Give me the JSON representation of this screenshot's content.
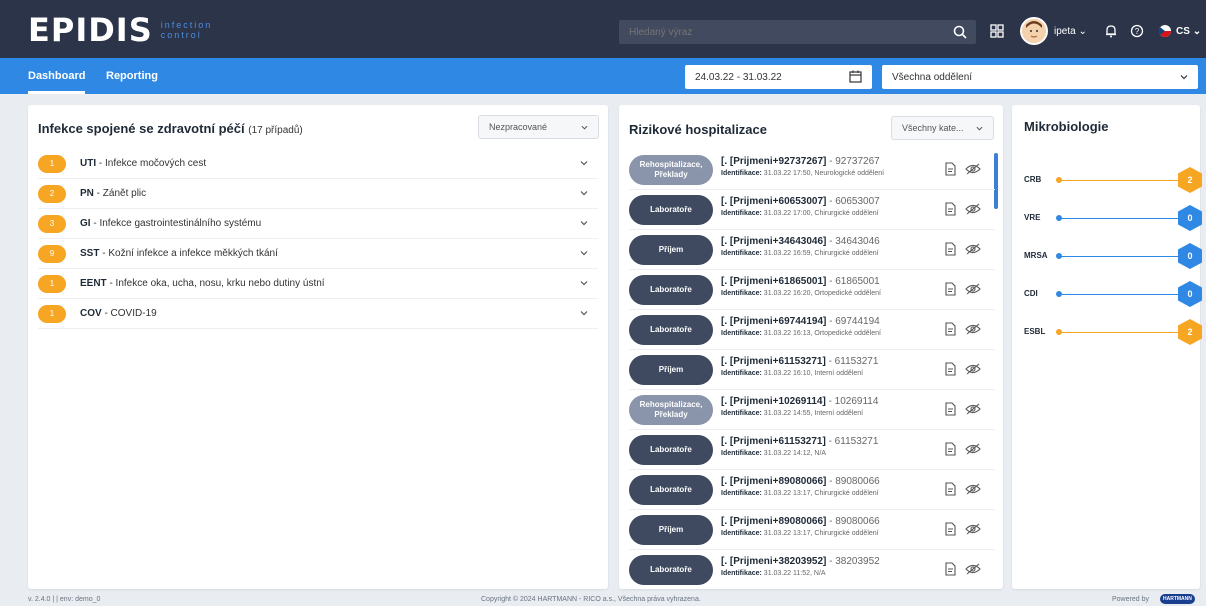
{
  "header": {
    "logo_text": "EPIDIS",
    "logo_sub_line1": "infection",
    "logo_sub_line2": "control",
    "search_placeholder": "Hledaný výraz",
    "username": "ipeta",
    "language": "CS"
  },
  "nav": {
    "tabs": [
      {
        "label": "Dashboard"
      },
      {
        "label": "Reporting"
      }
    ],
    "date_range": "24.03.22 - 31.03.22",
    "department": "Všechna oddělení"
  },
  "infections": {
    "title": "Infekce spojené se zdravotní péčí",
    "count": "(17 případů)",
    "filter": "Nezpracované",
    "rows": [
      {
        "count": "1",
        "code": "UTI",
        "desc": " - Infekce močových cest"
      },
      {
        "count": "2",
        "code": "PN",
        "desc": " - Zánět plic"
      },
      {
        "count": "3",
        "code": "GI",
        "desc": " - Infekce gastrointestinálního systému"
      },
      {
        "count": "9",
        "code": "SST",
        "desc": " - Kožní infekce a infekce měkkých tkání"
      },
      {
        "count": "1",
        "code": "EENT",
        "desc": " - Infekce oka, ucha, nosu, krku nebo dutiny ústní"
      },
      {
        "count": "1",
        "code": "COV",
        "desc": " - COVID-19"
      }
    ]
  },
  "hospitalizations": {
    "title": "Rizikové hospitalizace",
    "filter": "Všechny kate...",
    "detail_label": "Identifikace:",
    "rows": [
      {
        "pill": "Rehospitalizace, Překlady",
        "light": true,
        "name": "[. [Prijmeni+92737267]",
        "id": " - 92737267",
        "detail": " 31.03.22 17:50, Neurologické oddělení"
      },
      {
        "pill": "Laboratoře",
        "light": false,
        "name": "[. [Prijmeni+60653007]",
        "id": " - 60653007",
        "detail": " 31.03.22 17:00, Chirurgické oddělení"
      },
      {
        "pill": "Příjem",
        "light": false,
        "name": "[. [Prijmeni+34643046]",
        "id": " - 34643046",
        "detail": " 31.03.22 16:59, Chirurgické oddělení"
      },
      {
        "pill": "Laboratoře",
        "light": false,
        "name": "[. [Prijmeni+61865001]",
        "id": " - 61865001",
        "detail": " 31.03.22 16:20, Ortopedické oddělení"
      },
      {
        "pill": "Laboratoře",
        "light": false,
        "name": "[. [Prijmeni+69744194]",
        "id": " - 69744194",
        "detail": " 31.03.22 16:13, Ortopedické oddělení"
      },
      {
        "pill": "Příjem",
        "light": false,
        "name": "[. [Prijmeni+61153271]",
        "id": " - 61153271",
        "detail": " 31.03.22 16:10, Interní oddělení"
      },
      {
        "pill": "Rehospitalizace, Překlady",
        "light": true,
        "name": "[. [Prijmeni+10269114]",
        "id": " - 10269114",
        "detail": " 31.03.22 14:55, Interní oddělení"
      },
      {
        "pill": "Laboratoře",
        "light": false,
        "name": "[. [Prijmeni+61153271]",
        "id": " - 61153271",
        "detail": " 31.03.22 14:12, N/A"
      },
      {
        "pill": "Laboratoře",
        "light": false,
        "name": "[. [Prijmeni+89080066]",
        "id": " - 89080066",
        "detail": " 31.03.22 13:17, Chirurgické oddělení"
      },
      {
        "pill": "Příjem",
        "light": false,
        "name": "[. [Prijmeni+89080066]",
        "id": " - 89080066",
        "detail": " 31.03.22 13:17, Chirurgické oddělení"
      },
      {
        "pill": "Laboratoře",
        "light": false,
        "name": "[. [Prijmeni+38203952]",
        "id": " - 38203952",
        "detail": " 31.03.22 11:52, N/A"
      }
    ]
  },
  "microbiology": {
    "title": "Mikrobiologie",
    "rows": [
      {
        "label": "CRB",
        "value": "2",
        "color": "#f6a623"
      },
      {
        "label": "VRE",
        "value": "0",
        "color": "#2f89e4"
      },
      {
        "label": "MRSA",
        "value": "0",
        "color": "#2f89e4"
      },
      {
        "label": "CDI",
        "value": "0",
        "color": "#2f89e4"
      },
      {
        "label": "ESBL",
        "value": "2",
        "color": "#f6a623"
      }
    ]
  },
  "footer": {
    "version": "v. 2.4.0 | | env: demo_0",
    "copyright": "Copyright © 2024 HARTMANN - RICO a.s., Všechna práva vyhrazena.",
    "powered": "Powered by",
    "brand": "HARTMANN"
  }
}
